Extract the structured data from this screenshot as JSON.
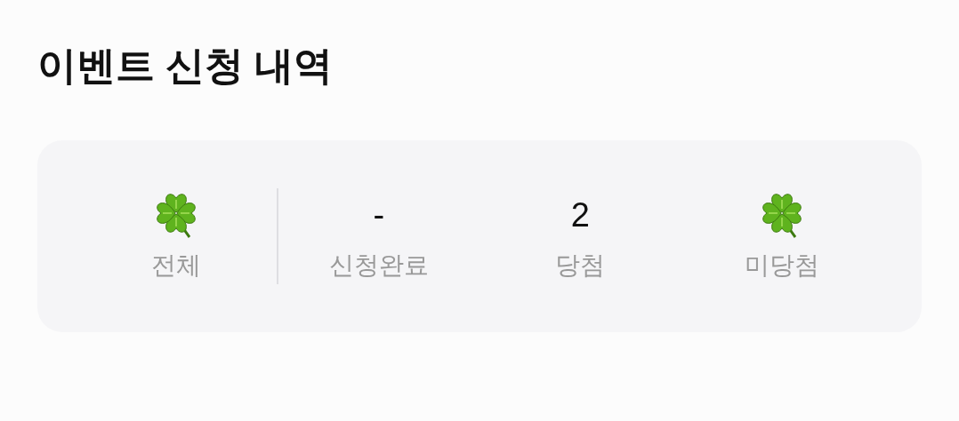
{
  "title": "이벤트 신청 내역",
  "stats": [
    {
      "kind": "icon",
      "label": "전체"
    },
    {
      "kind": "text",
      "value": "-",
      "label": "신청완료"
    },
    {
      "kind": "text",
      "value": "2",
      "label": "당첨"
    },
    {
      "kind": "icon",
      "label": "미당첨"
    }
  ]
}
